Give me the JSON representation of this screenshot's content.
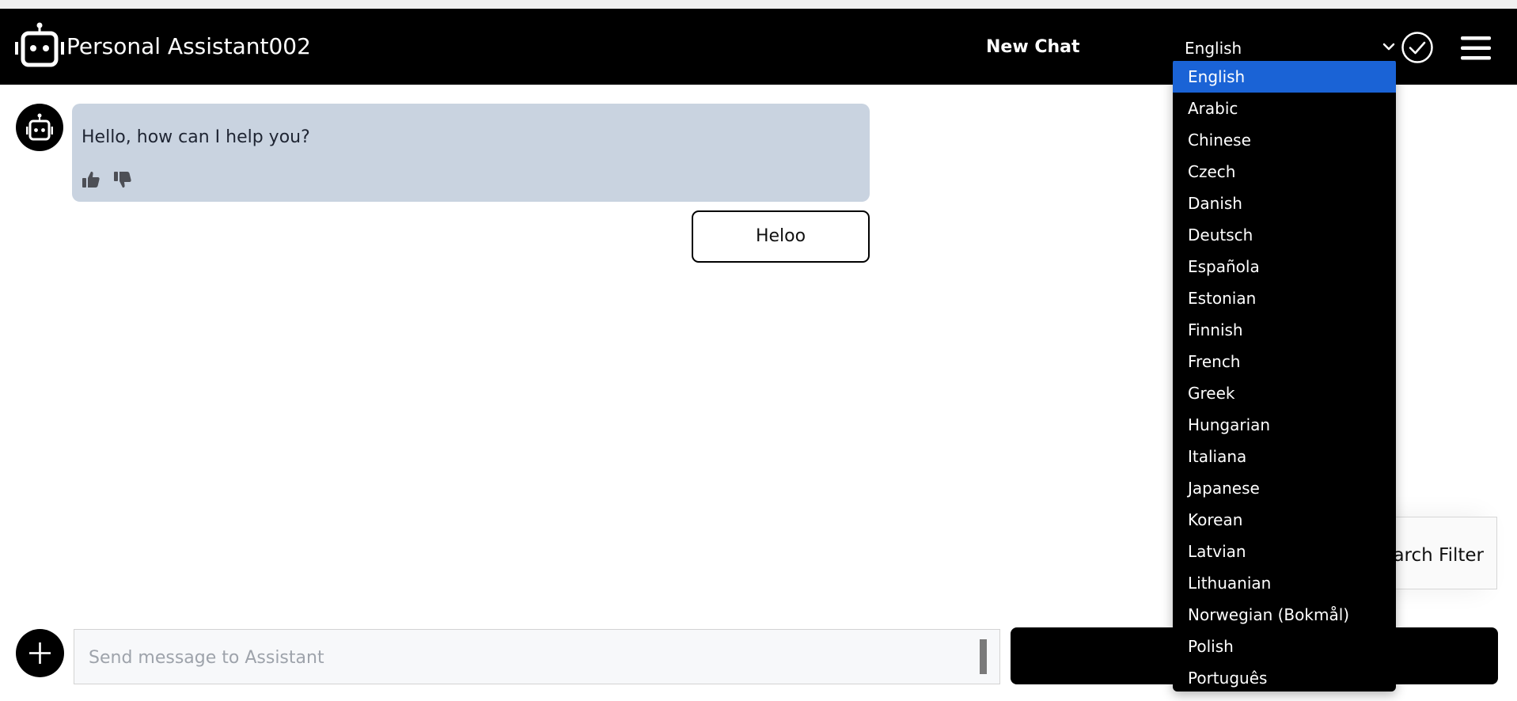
{
  "header": {
    "app_title": "Personal Assistant002",
    "new_chat_label": "New Chat",
    "selected_language": "English"
  },
  "chat": {
    "messages": [
      {
        "role": "assistant",
        "text": "Hello, how can I help you?"
      },
      {
        "role": "user",
        "text": "Heloo"
      }
    ]
  },
  "language_dropdown": {
    "options": [
      "English",
      "Arabic",
      "Chinese",
      "Czech",
      "Danish",
      "Deutsch",
      "Española",
      "Estonian",
      "Finnish",
      "French",
      "Greek",
      "Hungarian",
      "Italiana",
      "Japanese",
      "Korean",
      "Latvian",
      "Lithuanian",
      "Norwegian (Bokmål)",
      "Polish",
      "Português"
    ],
    "selected_index": 0
  },
  "search_filter": {
    "label_visible": "arch Filter"
  },
  "composer": {
    "placeholder": "Send message to Assistant"
  },
  "colors": {
    "header_bg": "#000000",
    "assistant_bubble": "#c9d3e0",
    "dropdown_selected": "#1a63d6"
  },
  "icons": {
    "logo": "robot-icon",
    "confirm": "check-circle-icon",
    "menu": "hamburger-menu-icon",
    "chevron": "chevron-down-icon",
    "like": "thumbs-up-icon",
    "dislike": "thumbs-down-icon",
    "add": "plus-icon"
  }
}
